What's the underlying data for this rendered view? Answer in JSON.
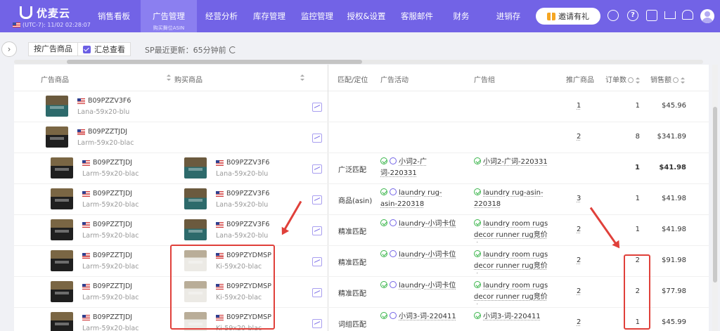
{
  "app": {
    "brand": "优麦云",
    "timezone": "(UTC-7): 11/02 02:28:07"
  },
  "nav": {
    "items": [
      "销售看板",
      "广告管理",
      "经营分析",
      "库存管理",
      "监控管理",
      "授权&设置",
      "客服邮件",
      "财务",
      "进销存"
    ],
    "active_sub": "购买舞位ASIN",
    "invite": "邀请有礼",
    "icons": [
      "headset-icon",
      "help-icon",
      "message-icon",
      "cart-icon",
      "bell-icon",
      "avatar"
    ]
  },
  "toolbar": {
    "group_select": "按广告商品",
    "summary_label": "汇总查看",
    "summary_checked": true,
    "sp_update": "SP最近更新：65分钟前"
  },
  "columns": {
    "ad_product": "广告商品",
    "purchased_product": "购买商品",
    "match": "匹配/定位",
    "campaign": "广告活动",
    "ad_group": "广告组",
    "promoted": "推广商品",
    "orders": "订单数",
    "sales": "销售额"
  },
  "rows": [
    {
      "ad_asin": "B09PZZV3F6",
      "ad_sku": "Lana-59x20-blu",
      "buy_asin": "",
      "buy_sku": "",
      "match": "",
      "campaign": "",
      "group": "",
      "promoted": "1",
      "orders": "1",
      "sales": "$45.96",
      "bold": false
    },
    {
      "ad_asin": "B09PZZTJDJ",
      "ad_sku": "Larm-59x20-blac",
      "buy_asin": "",
      "buy_sku": "",
      "match": "",
      "campaign": "",
      "group": "",
      "promoted": "2",
      "orders": "8",
      "sales": "$341.89",
      "bold": false
    },
    {
      "ad_asin": "B09PZZTJDJ",
      "ad_sku": "Larm-59x20-blac",
      "buy_asin": "B09PZZV3F6",
      "buy_sku": "Lana-59x20-blu",
      "match": "广泛匹配",
      "campaign": "小词2-广词-220331",
      "group": "小词2-广词-220331",
      "promoted": "",
      "orders": "1",
      "sales": "$41.98",
      "bold": true
    },
    {
      "ad_asin": "B09PZZTJDJ",
      "ad_sku": "Larm-59x20-blac",
      "buy_asin": "B09PZZV3F6",
      "buy_sku": "Lana-59x20-blu",
      "match": "商品(asin)",
      "campaign": "laundry rug-asin-220318",
      "group": "laundry rug-asin-220318",
      "promoted": "3",
      "orders": "1",
      "sales": "$41.98",
      "bold": false
    },
    {
      "ad_asin": "B09PZZTJDJ",
      "ad_sku": "Larm-59x20-blac",
      "buy_asin": "B09PZZV3F6",
      "buy_sku": "Lana-59x20-blu",
      "match": "精准匹配",
      "campaign": "laundry-小词卡位",
      "group": "laundry room rugs decor runner rug竞价卡...",
      "promoted": "2",
      "orders": "1",
      "sales": "$41.98",
      "bold": false
    },
    {
      "ad_asin": "B09PZZTJDJ",
      "ad_sku": "Larm-59x20-blac",
      "buy_asin": "B09PZYDMSP",
      "buy_sku": "Ki-59x20-blac",
      "match": "精准匹配",
      "campaign": "laundry-小词卡位",
      "group": "laundry room rugs decor runner rug竞价卡...",
      "promoted": "2",
      "orders": "2",
      "sales": "$91.98",
      "bold": false
    },
    {
      "ad_asin": "B09PZZTJDJ",
      "ad_sku": "Larm-59x20-blac",
      "buy_asin": "B09PZYDMSP",
      "buy_sku": "Ki-59x20-blac",
      "match": "精准匹配",
      "campaign": "laundry-小词卡位",
      "group": "laundry room rugs decor runner rug竞价卡...",
      "promoted": "2",
      "orders": "2",
      "sales": "$77.98",
      "bold": false
    },
    {
      "ad_asin": "B09PZZTJDJ",
      "ad_sku": "Larm-59x20-blac",
      "buy_asin": "B09PZYDMSP",
      "buy_sku": "Ki-59x20-blac",
      "match": "词组匹配",
      "campaign": "小词3-词-220411",
      "group": "小词3-词-220411",
      "promoted": "2",
      "orders": "1",
      "sales": "$45.99",
      "bold": false
    }
  ],
  "colors": {
    "brand": "#7263e6",
    "highlight": "#e0403a",
    "ok": "#39b54a"
  }
}
